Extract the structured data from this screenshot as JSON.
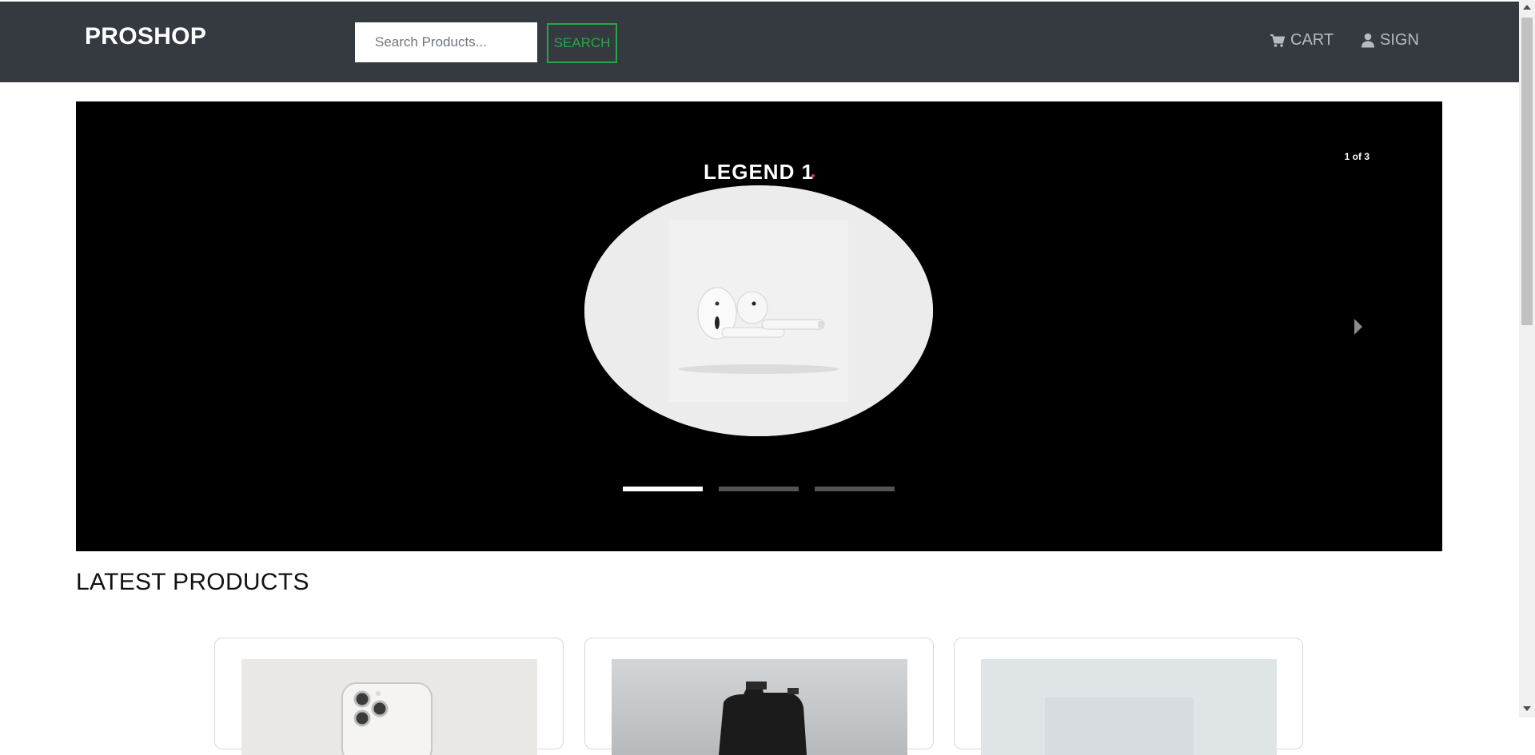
{
  "navbar": {
    "brand": "PROSHOP",
    "search": {
      "placeholder": "Search Products...",
      "value": ""
    },
    "search_button": "SEARCH",
    "cart_label": "CART",
    "sign_label": "SIGN",
    "icons": {
      "cart": "shopping-cart-icon",
      "user": "user-icon"
    }
  },
  "carousel": {
    "legend": "LEGEND 1",
    "counter": "1 of 3",
    "slide_count": 3,
    "active_slide": 1,
    "image": "airpods-product-image"
  },
  "latest": {
    "title": "LATEST PRODUCTS",
    "products": [
      {
        "image": "iphone-product-image"
      },
      {
        "image": "camera-product-image"
      },
      {
        "image": "device-product-image"
      }
    ]
  },
  "colors": {
    "navbar_bg": "#343a40",
    "accent_green": "#28a745",
    "carousel_bg": "#000000"
  }
}
